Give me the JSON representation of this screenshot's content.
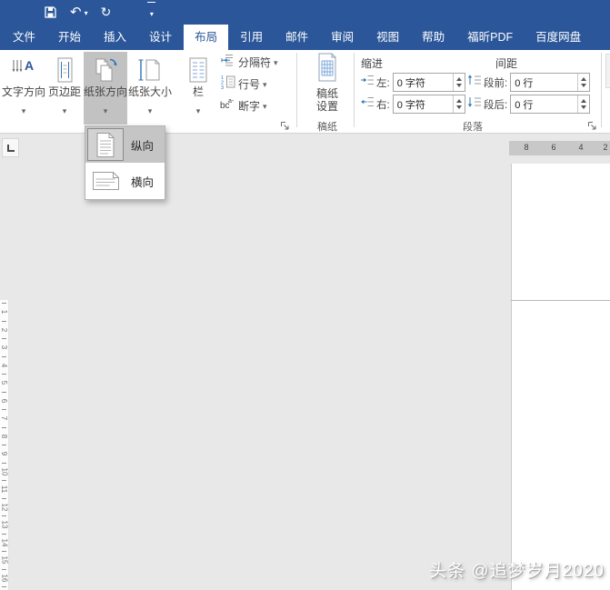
{
  "titlebar": {
    "qat_icons": [
      "save",
      "undo",
      "redo",
      "customize-quick-access-toolbar"
    ]
  },
  "tabs": [
    {
      "label": "文件",
      "active": false
    },
    {
      "label": "开始",
      "active": false
    },
    {
      "label": "插入",
      "active": false
    },
    {
      "label": "设计",
      "active": false
    },
    {
      "label": "布局",
      "active": true
    },
    {
      "label": "引用",
      "active": false
    },
    {
      "label": "邮件",
      "active": false
    },
    {
      "label": "审阅",
      "active": false
    },
    {
      "label": "视图",
      "active": false
    },
    {
      "label": "帮助",
      "active": false
    },
    {
      "label": "福昕PDF",
      "active": false
    },
    {
      "label": "百度网盘",
      "active": false
    }
  ],
  "ribbon": {
    "page_setup": {
      "buttons": [
        {
          "label": "文字方向",
          "icon": "text-direction-icon",
          "pressed": false
        },
        {
          "label": "页边距",
          "icon": "margins-icon",
          "pressed": false
        },
        {
          "label": "纸张方向",
          "icon": "orientation-icon",
          "pressed": true
        },
        {
          "label": "纸张大小",
          "icon": "paper-size-icon",
          "pressed": false
        },
        {
          "label": "栏",
          "icon": "columns-icon",
          "pressed": false
        }
      ],
      "small_buttons": [
        {
          "label": "分隔符",
          "icon": "breaks-icon"
        },
        {
          "label": "行号",
          "icon": "line-numbers-icon"
        },
        {
          "label": "断字",
          "icon": "hyphenation-icon"
        }
      ]
    },
    "manuscript": {
      "button_line1": "稿纸",
      "button_line2": "设置",
      "group_label": "稿纸"
    },
    "paragraph": {
      "indent_heading": "缩进",
      "spacing_heading": "间距",
      "indent_left_label": "左:",
      "indent_left_value": "0 字符",
      "indent_right_label": "右:",
      "indent_right_value": "0 字符",
      "spacing_before_label": "段前:",
      "spacing_before_value": "0 行",
      "spacing_after_label": "段后:",
      "spacing_after_value": "0 行",
      "group_label": "段落"
    }
  },
  "orientation_menu": {
    "items": [
      {
        "label": "纵向",
        "selected": true,
        "icon": "portrait-page-icon"
      },
      {
        "label": "横向",
        "selected": false,
        "icon": "landscape-page-icon"
      }
    ]
  },
  "rulers": {
    "horizontal_numbers": [
      "8",
      "6",
      "4",
      "2"
    ],
    "vertical_numbers": [
      "1",
      "2",
      "3",
      "4",
      "5",
      "6",
      "7",
      "8",
      "9",
      "10",
      "11",
      "12",
      "13",
      "14",
      "15",
      "16"
    ]
  },
  "watermark": "头条 @追梦岁月2020",
  "colors": {
    "accent_blue": "#2b579a",
    "icon_blue": "#2e75b6",
    "pressed_gray": "#c2c2c2",
    "workspace_gray": "#e8e8e8",
    "ruler_gray": "#c8c8c8"
  }
}
